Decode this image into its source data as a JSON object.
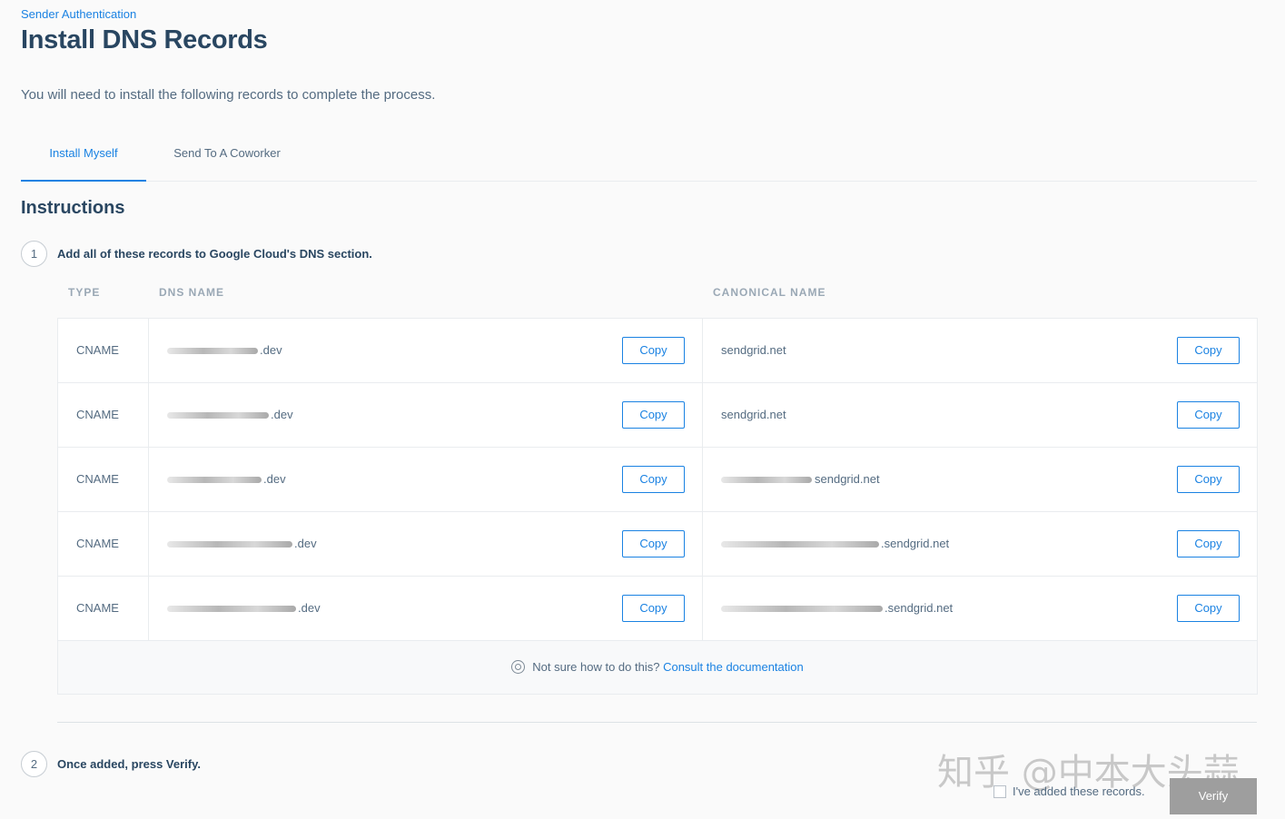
{
  "breadcrumb": "Sender Authentication",
  "title": "Install DNS Records",
  "intro": "You will need to install the following records to complete the process.",
  "tabs": [
    {
      "label": "Install Myself",
      "active": true
    },
    {
      "label": "Send To A Coworker",
      "active": false
    }
  ],
  "section_title": "Instructions",
  "steps": [
    {
      "number": "1",
      "text": "Add all of these records to Google Cloud's DNS section."
    },
    {
      "number": "2",
      "text": "Once added, press Verify."
    }
  ],
  "table": {
    "headers": {
      "type": "TYPE",
      "dns": "DNS NAME",
      "canonical": "CANONICAL NAME"
    },
    "copy_label": "Copy",
    "rows": [
      {
        "type": "CNAME",
        "dns_suffix": ".dev",
        "canonical": "sendgrid.net"
      },
      {
        "type": "CNAME",
        "dns_suffix": ".dev",
        "canonical": "sendgrid.net"
      },
      {
        "type": "CNAME",
        "dns_suffix": ".dev",
        "canonical": "sendgrid.net"
      },
      {
        "type": "CNAME",
        "dns_suffix": ".dev",
        "canonical": ".sendgrid.net"
      },
      {
        "type": "CNAME",
        "dns_suffix": ".dev",
        "canonical": ".sendgrid.net"
      }
    ]
  },
  "help": {
    "text": "Not sure how to do this?",
    "link": "Consult the documentation"
  },
  "checkbox_label": "I've added these records.",
  "verify_label": "Verify",
  "watermark": "知乎 @中本大头蒜"
}
